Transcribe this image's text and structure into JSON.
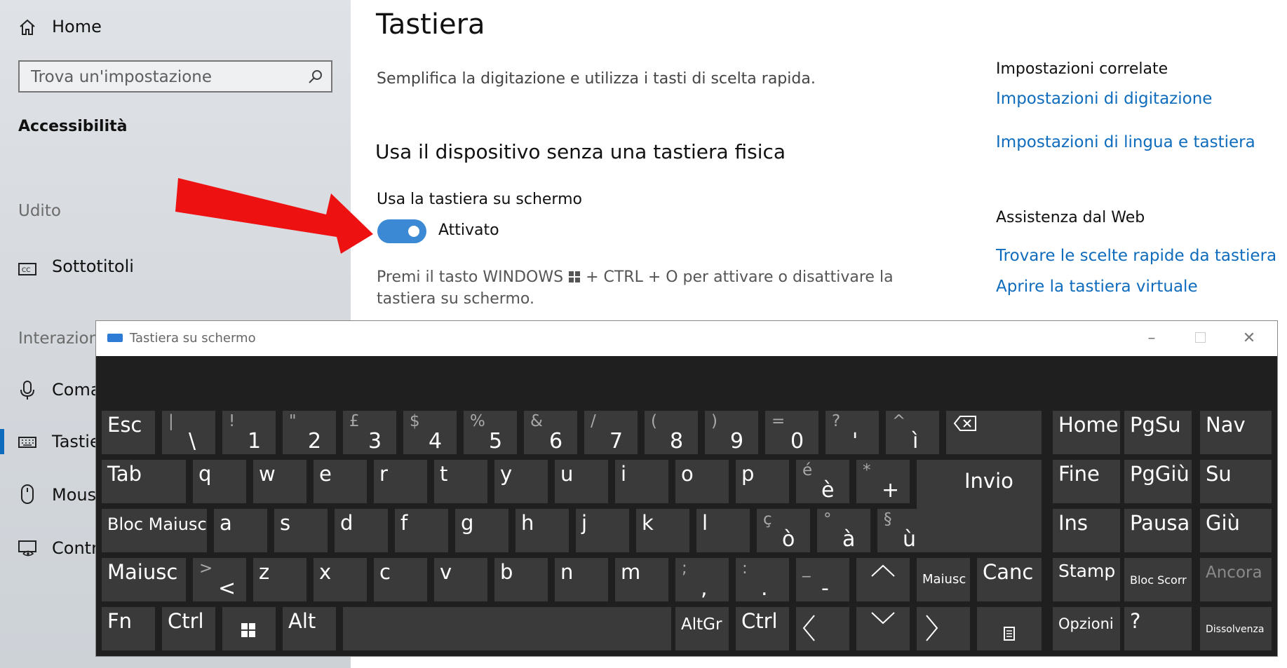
{
  "sidebar": {
    "home_label": "Home",
    "search_placeholder": "Trova un'impostazione",
    "section_title": "Accessibilità",
    "group_udito": "Udito",
    "item_sottotitoli": "Sottotitoli",
    "group_interazione": "Interazione",
    "item_comandi": "Coma",
    "item_tastiera": "Tastier",
    "item_mouse": "Mouse",
    "item_controllo": "Contro"
  },
  "main": {
    "title": "Tastiera",
    "subtitle": "Semplifica la digitazione e utilizza i tasti di scelta rapida.",
    "section_heading": "Usa il dispositivo senza una tastiera fisica",
    "toggle_label": "Usa la tastiera su schermo",
    "toggle_state": "Attivato",
    "hint_line1_pre": "Premi il tasto WINDOWS",
    "hint_line1_post": "+ CTRL + O per attivare o disattivare la",
    "hint_line2": "tastiera su schermo."
  },
  "related": {
    "heading": "Impostazioni correlate",
    "link1": "Impostazioni di digitazione",
    "link2": "Impostazioni di lingua e tastiera",
    "web_heading": "Assistenza dal Web",
    "link3": "Trovare le scelte rapide da tastiera",
    "link4": "Aprire la tastiera virtuale"
  },
  "osk": {
    "title": "Tastiera su schermo",
    "keys": {
      "esc": "Esc",
      "k_bs_s": "|",
      "k_bs": "\\",
      "k1_s": "!",
      "k1": "1",
      "k2_s": "\"",
      "k2": "2",
      "k3_s": "£",
      "k3": "3",
      "k4_s": "$",
      "k4": "4",
      "k5_s": "%",
      "k5": "5",
      "k6_s": "&",
      "k6": "6",
      "k7_s": "/",
      "k7": "7",
      "k8_s": "(",
      "k8": "8",
      "k9_s": ")",
      "k9": "9",
      "k0_s": "=",
      "k0": "0",
      "kq_s": "?",
      "kq": "'",
      "ki_s": "^",
      "ki": "ì",
      "tab": "Tab",
      "q": "q",
      "w": "w",
      "e": "e",
      "r": "r",
      "t": "t",
      "y": "y",
      "u": "u",
      "i": "i",
      "o": "o",
      "p": "p",
      "egr_s": "é",
      "egr": "è",
      "plus_s": "*",
      "plus": "+",
      "invio": "Invio",
      "caps": "Bloc Maiusc",
      "a": "a",
      "s": "s",
      "d": "d",
      "f": "f",
      "g": "g",
      "h": "h",
      "j": "j",
      "k": "k",
      "l": "l",
      "ogr_s": "ç",
      "ogr": "ò",
      "agr_s": "°",
      "agr": "à",
      "ugr_s": "§",
      "ugr": "ù",
      "lshift": "Maiusc",
      "lt_s": ">",
      "lt": "<",
      "z": "z",
      "x": "x",
      "c": "c",
      "v": "v",
      "b": "b",
      "n": "n",
      "m": "m",
      "comma_s": ";",
      "comma": ",",
      "dot_s": ":",
      "dot": ".",
      "dash_s": "_",
      "dash": "-",
      "rshift": "Maiusc",
      "canc": "Canc",
      "fn": "Fn",
      "ctrl": "Ctrl",
      "alt": "Alt",
      "altgr": "AltGr",
      "rctrl": "Ctrl",
      "home": "Home",
      "pgsu": "PgSu",
      "nav": "Nav",
      "fine": "Fine",
      "pggiu": "PgGiù",
      "su": "Su",
      "ins": "Ins",
      "pausa": "Pausa",
      "giu": "Giù",
      "stamp": "Stamp",
      "blocscorr": "Bloc Scorr",
      "ancora": "Ancora",
      "opzioni": "Opzioni",
      "help": "?",
      "dissolvenza": "Dissolvenza"
    }
  },
  "colors": {
    "accent": "#0f6cbd",
    "toggle_on": "#3b89d4",
    "arrow": "#ee1111",
    "key_bg": "#3a3a3a",
    "keyboard_bg": "#1f1f1f"
  }
}
